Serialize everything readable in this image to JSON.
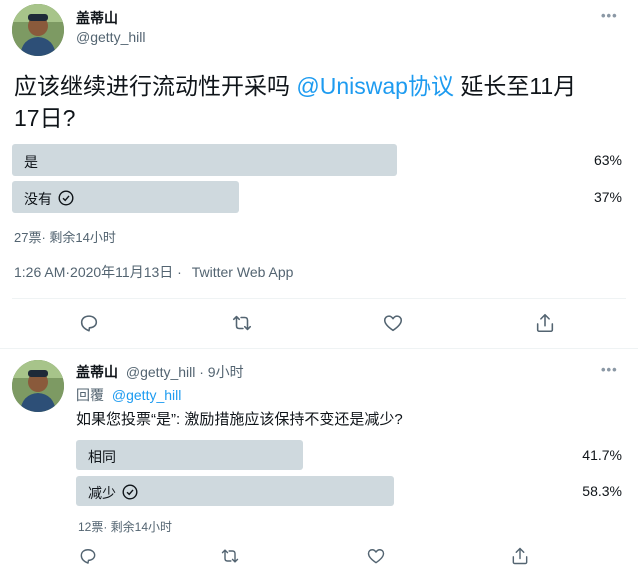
{
  "tweet1": {
    "author_name": "盖蒂山",
    "author_handle": "@getty_hill",
    "more_label": "•••",
    "text_prefix": "应该继续进行流动性开采吗",
    "text_mention": "@Uniswap协议",
    "text_suffix_line1": "延长至11月",
    "text_line2": "17日?",
    "poll": {
      "options": [
        {
          "label": "是",
          "percent": "63%",
          "value": 0.63,
          "winner": false
        },
        {
          "label": "没有",
          "percent": "37%",
          "value": 0.37,
          "winner": true
        }
      ],
      "summary": "27票· 剩余14小时"
    },
    "timestamp": "1:26 AM·2020年11月13日 ·",
    "source": "Twitter Web App"
  },
  "reply": {
    "author_name": "盖蒂山",
    "author_handle": "@getty_hill",
    "time": "· 9小时",
    "more_label": "•••",
    "replying_prefix": "回覆",
    "replying_handle": "@getty_hill",
    "text": "如果您投票“是”: 激励措施应该保持不变还是减少?",
    "poll": {
      "options": [
        {
          "label": "相同",
          "percent": "41.7%",
          "value": 0.417,
          "winner": false
        },
        {
          "label": "减少",
          "percent": "58.3%",
          "value": 0.583,
          "winner": true
        }
      ],
      "summary": "12票· 剩余14小时"
    }
  },
  "actions": {
    "reply_icon": "reply-icon",
    "retweet_icon": "retweet-icon",
    "like_icon": "heart-icon",
    "share_icon": "share-icon"
  },
  "colors": {
    "link": "#1d9bf0",
    "bar": "#cfd9de",
    "muted": "#536471"
  }
}
